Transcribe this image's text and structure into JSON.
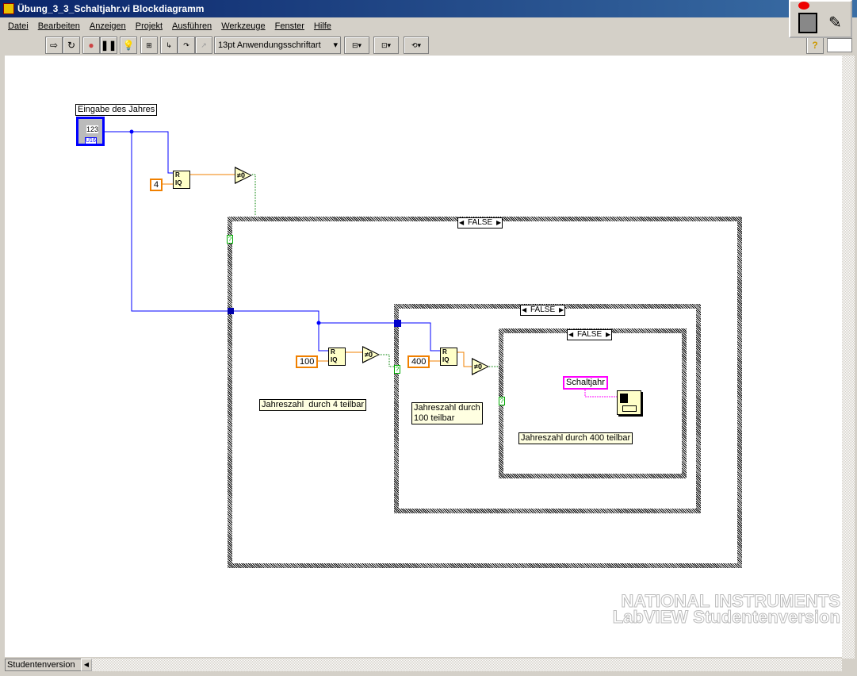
{
  "window": {
    "title": "Übung_3_3_Schaltjahr.vi Blockdiagramm"
  },
  "menu": [
    "Datei",
    "Bearbeiten",
    "Anzeigen",
    "Projekt",
    "Ausführen",
    "Werkzeuge",
    "Fenster",
    "Hilfe"
  ],
  "toolbar": {
    "font": "13pt Anwendungsschriftart",
    "help": "?"
  },
  "diagram": {
    "control_label": "Eingabe des Jahres",
    "control_value": "123",
    "control_type": "U16",
    "const_4": "4",
    "const_100": "100",
    "const_400": "400",
    "case_outer": "FALSE",
    "case_middle": "FALSE",
    "case_inner": "FALSE",
    "selector": "?",
    "quotient": "R\nIQ",
    "not_equal_zero": "≠0",
    "comment_4": "Jahreszahl  durch 4 teilbar",
    "comment_100": "Jahreszahl durch\n100 teilbar",
    "comment_400": "Jahreszahl durch 400 teilbar",
    "string_const": "Schaltjahr"
  },
  "watermark": "NATIONAL INSTRUMENTS LabVIEW Studentenversion",
  "status": "Studentenversion",
  "colors": {
    "integer_wire": "#0000ff",
    "numeric_const": "#f08000",
    "boolean_wire": "#008000",
    "string": "#ff00ff"
  }
}
